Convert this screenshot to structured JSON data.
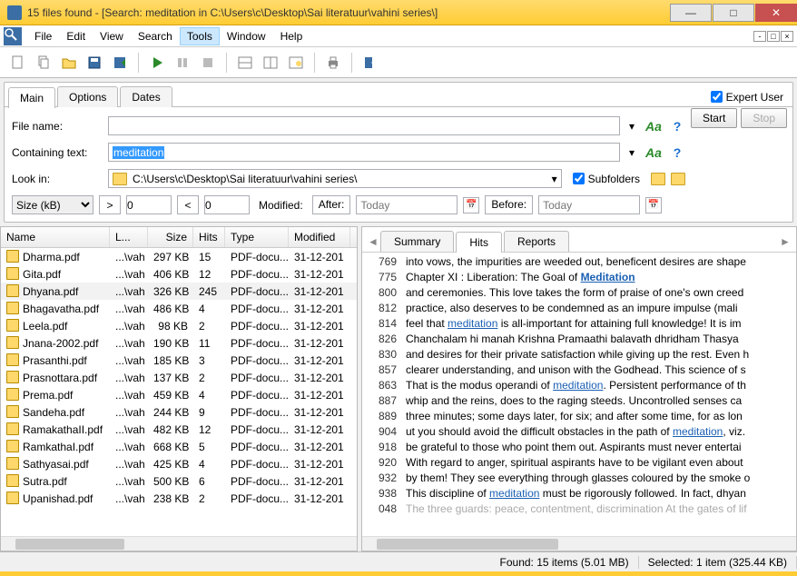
{
  "window": {
    "title": "15 files found - [Search: meditation in C:\\Users\\c\\Desktop\\Sai literatuur\\vahini series\\]"
  },
  "menus": {
    "file": "File",
    "edit": "Edit",
    "view": "View",
    "search": "Search",
    "tools": "Tools",
    "window": "Window",
    "help": "Help"
  },
  "tabs": {
    "main": "Main",
    "options": "Options",
    "dates": "Dates"
  },
  "expert": {
    "label": "Expert User"
  },
  "buttons": {
    "start": "Start",
    "stop": "Stop"
  },
  "form": {
    "filename_label": "File name:",
    "filename_value": "",
    "containing_label": "Containing text:",
    "containing_value": "meditation",
    "lookin_label": "Look in:",
    "lookin_value": "C:\\Users\\c\\Desktop\\Sai literatuur\\vahini series\\",
    "subfolders_label": "Subfolders",
    "size_label": "Size (kB)",
    "gt": ">",
    "lt": "<",
    "gt_val": "0",
    "lt_val": "0",
    "modified_label": "Modified:",
    "after": "After:",
    "before": "Before:",
    "today": "Today"
  },
  "columns": {
    "name": "Name",
    "location": "L...",
    "size": "Size",
    "hits": "Hits",
    "type": "Type",
    "modified": "Modified"
  },
  "files": [
    {
      "name": "Dharma.pdf",
      "loc": "...\\vah",
      "size": "297 KB",
      "hits": "15",
      "type": "PDF-docu...",
      "mod": "31-12-201"
    },
    {
      "name": "Gita.pdf",
      "loc": "...\\vah",
      "size": "406 KB",
      "hits": "12",
      "type": "PDF-docu...",
      "mod": "31-12-201"
    },
    {
      "name": "Dhyana.pdf",
      "loc": "...\\vah",
      "size": "326 KB",
      "hits": "245",
      "type": "PDF-docu...",
      "mod": "31-12-201",
      "selected": true
    },
    {
      "name": "Bhagavatha.pdf",
      "loc": "...\\vah",
      "size": "486 KB",
      "hits": "4",
      "type": "PDF-docu...",
      "mod": "31-12-201"
    },
    {
      "name": "Leela.pdf",
      "loc": "...\\vah",
      "size": "98 KB",
      "hits": "2",
      "type": "PDF-docu...",
      "mod": "31-12-201"
    },
    {
      "name": "Jnana-2002.pdf",
      "loc": "...\\vah",
      "size": "190 KB",
      "hits": "11",
      "type": "PDF-docu...",
      "mod": "31-12-201"
    },
    {
      "name": "Prasanthi.pdf",
      "loc": "...\\vah",
      "size": "185 KB",
      "hits": "3",
      "type": "PDF-docu...",
      "mod": "31-12-201"
    },
    {
      "name": "Prasnottara.pdf",
      "loc": "...\\vah",
      "size": "137 KB",
      "hits": "2",
      "type": "PDF-docu...",
      "mod": "31-12-201"
    },
    {
      "name": "Prema.pdf",
      "loc": "...\\vah",
      "size": "459 KB",
      "hits": "4",
      "type": "PDF-docu...",
      "mod": "31-12-201"
    },
    {
      "name": "Sandeha.pdf",
      "loc": "...\\vah",
      "size": "244 KB",
      "hits": "9",
      "type": "PDF-docu...",
      "mod": "31-12-201"
    },
    {
      "name": "RamakathaII.pdf",
      "loc": "...\\vah",
      "size": "482 KB",
      "hits": "12",
      "type": "PDF-docu...",
      "mod": "31-12-201"
    },
    {
      "name": "RamkathaI.pdf",
      "loc": "...\\vah",
      "size": "668 KB",
      "hits": "5",
      "type": "PDF-docu...",
      "mod": "31-12-201"
    },
    {
      "name": "Sathyasai.pdf",
      "loc": "...\\vah",
      "size": "425 KB",
      "hits": "4",
      "type": "PDF-docu...",
      "mod": "31-12-201"
    },
    {
      "name": "Sutra.pdf",
      "loc": "...\\vah",
      "size": "500 KB",
      "hits": "6",
      "type": "PDF-docu...",
      "mod": "31-12-201"
    },
    {
      "name": "Upanishad.pdf",
      "loc": "...\\vah",
      "size": "238 KB",
      "hits": "2",
      "type": "PDF-docu...",
      "mod": "31-12-201"
    }
  ],
  "right_tabs": {
    "summary": "Summary",
    "hits": "Hits",
    "reports": "Reports"
  },
  "hits": [
    {
      "n": "769",
      "t": "into vows, the impurities are weeded out, beneficent desires are shape"
    },
    {
      "n": "775",
      "t": "Chapter XI : Liberation: The Goal of ",
      "link": "Meditation",
      "bold": true
    },
    {
      "n": "800",
      "t": "and ceremonies. This love takes the form of praise of one's own creed"
    },
    {
      "n": "812",
      "t": "practice, also deserves to be condemned as an impure impulse (mali"
    },
    {
      "n": "814",
      "t": "feel that ",
      "link": "meditation",
      "tail": " is all-important for attaining full knowledge! It is im"
    },
    {
      "n": "826",
      "t": "Chanchalam hi manah Krishna Pramaathi balavath dhridham Thasya"
    },
    {
      "n": "830",
      "t": "and desires for their private satisfaction while giving up the rest. Even h"
    },
    {
      "n": "857",
      "t": "clearer understanding, and unison with the Godhead. This science of s"
    },
    {
      "n": "863",
      "t": "That is the modus operandi of ",
      "link": "meditation",
      "tail": ". Persistent performance of th"
    },
    {
      "n": "887",
      "t": "whip and the reins, does to the raging steeds. Uncontrolled senses ca"
    },
    {
      "n": "889",
      "t": "three minutes; some days later, for six; and after some time, for as lon"
    },
    {
      "n": "904",
      "t": "ut you should avoid the difficult obstacles in the path of ",
      "link": "meditation",
      "tail": ", viz."
    },
    {
      "n": "918",
      "t": "be grateful to those who point them out. Aspirants must never entertai"
    },
    {
      "n": "920",
      "t": "With regard to anger, spiritual aspirants have to be vigilant even about"
    },
    {
      "n": "932",
      "t": "by them! They see everything through glasses coloured by the smoke o"
    },
    {
      "n": "938",
      "t": "This discipline of ",
      "link": "meditation",
      "tail": " must be rigorously followed. In fact, dhyan"
    },
    {
      "n": "048",
      "t": "The three guards: peace, contentment, discrimination At the gates of lif",
      "dim": true
    }
  ],
  "status": {
    "found": "Found: 15 items (5.01 MB)",
    "selected": "Selected: 1 item (325.44 KB)"
  }
}
